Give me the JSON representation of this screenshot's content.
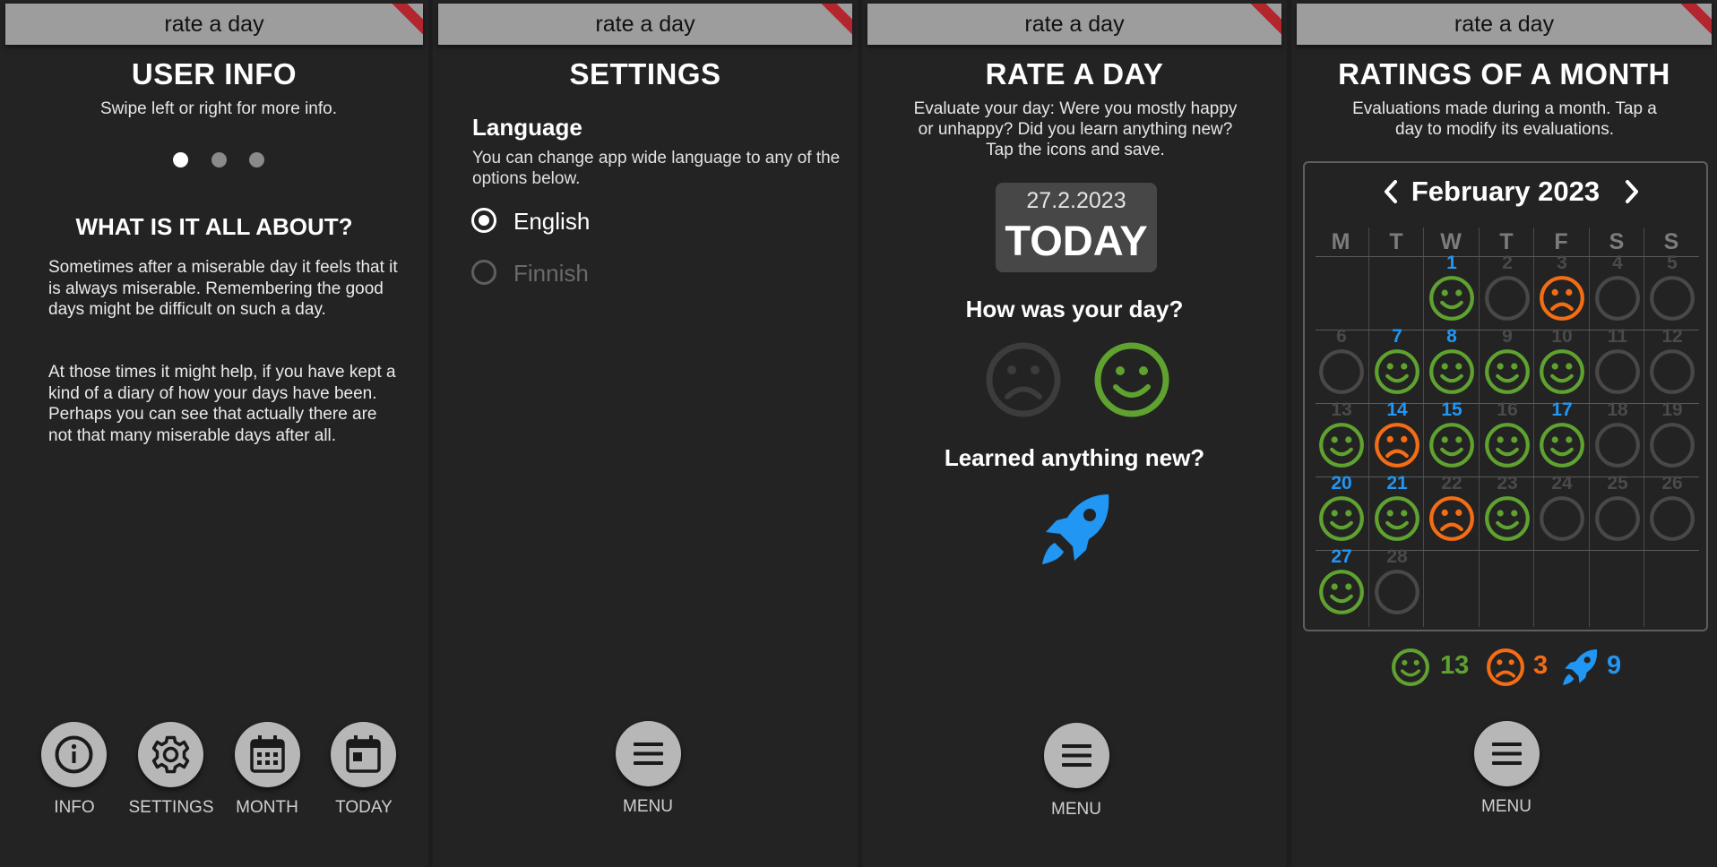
{
  "app_title": "rate a day",
  "colors": {
    "happy": "#5fa22f",
    "sad": "#f46d15",
    "learn": "#2196f3",
    "empty": "#484848"
  },
  "info": {
    "title": "USER INFO",
    "subtitle": "Swipe left or right for more info.",
    "heading": "WHAT IS IT ALL ABOUT?",
    "para1": "Sometimes after a miserable day it feels that it is always miserable. Remembering the good days might be difficult on such a day.",
    "para2": "At those times it might help, if you have kept a kind of a diary of how your days have been. Perhaps you can see that actually there are not that many miserable days after all.",
    "nav": [
      {
        "label": "INFO",
        "icon": "info-icon"
      },
      {
        "label": "SETTINGS",
        "icon": "gear-icon"
      },
      {
        "label": "MONTH",
        "icon": "calendar-month-icon"
      },
      {
        "label": "TODAY",
        "icon": "calendar-today-icon"
      }
    ]
  },
  "settings": {
    "title": "SETTINGS",
    "language_heading": "Language",
    "language_desc": "You can change app wide language to any of the options below.",
    "options": [
      {
        "label": "English",
        "selected": true
      },
      {
        "label": "Finnish",
        "selected": false
      }
    ],
    "menu_label": "MENU"
  },
  "rate": {
    "title": "RATE A DAY",
    "desc_line1": "Evaluate your day: Were you mostly happy",
    "desc_line2": "or unhappy? Did you learn anything new?",
    "desc_line3": "Tap the icons and save.",
    "date": "27.2.2023",
    "today": "TODAY",
    "how_question": "How was your day?",
    "learned_question": "Learned anything new?",
    "menu_label": "MENU"
  },
  "month": {
    "title": "RATINGS OF A MONTH",
    "desc_line1": "Evaluations made during a month. Tap a",
    "desc_line2": "day to modify its evaluations.",
    "month_label": "February 2023",
    "weekdays": [
      "M",
      "T",
      "W",
      "T",
      "F",
      "S",
      "S"
    ],
    "days": [
      {
        "n": "1",
        "c": 2,
        "r": 0,
        "mood": "happy",
        "learn": true
      },
      {
        "n": "2",
        "c": 3,
        "r": 0,
        "mood": "none",
        "learn": false
      },
      {
        "n": "3",
        "c": 4,
        "r": 0,
        "mood": "sad",
        "learn": false
      },
      {
        "n": "4",
        "c": 5,
        "r": 0,
        "mood": "none",
        "learn": false
      },
      {
        "n": "5",
        "c": 6,
        "r": 0,
        "mood": "none",
        "learn": false
      },
      {
        "n": "6",
        "c": 0,
        "r": 1,
        "mood": "none",
        "learn": false
      },
      {
        "n": "7",
        "c": 1,
        "r": 1,
        "mood": "happy",
        "learn": true
      },
      {
        "n": "8",
        "c": 2,
        "r": 1,
        "mood": "happy",
        "learn": true
      },
      {
        "n": "9",
        "c": 3,
        "r": 1,
        "mood": "happy",
        "learn": false
      },
      {
        "n": "10",
        "c": 4,
        "r": 1,
        "mood": "happy",
        "learn": false
      },
      {
        "n": "11",
        "c": 5,
        "r": 1,
        "mood": "none",
        "learn": false
      },
      {
        "n": "12",
        "c": 6,
        "r": 1,
        "mood": "none",
        "learn": false
      },
      {
        "n": "13",
        "c": 0,
        "r": 2,
        "mood": "happy",
        "learn": false
      },
      {
        "n": "14",
        "c": 1,
        "r": 2,
        "mood": "sad",
        "learn": true
      },
      {
        "n": "15",
        "c": 2,
        "r": 2,
        "mood": "happy",
        "learn": true
      },
      {
        "n": "16",
        "c": 3,
        "r": 2,
        "mood": "happy",
        "learn": false
      },
      {
        "n": "17",
        "c": 4,
        "r": 2,
        "mood": "happy",
        "learn": true
      },
      {
        "n": "18",
        "c": 5,
        "r": 2,
        "mood": "none",
        "learn": false
      },
      {
        "n": "19",
        "c": 6,
        "r": 2,
        "mood": "none",
        "learn": false
      },
      {
        "n": "20",
        "c": 0,
        "r": 3,
        "mood": "happy",
        "learn": true
      },
      {
        "n": "21",
        "c": 1,
        "r": 3,
        "mood": "happy",
        "learn": true
      },
      {
        "n": "22",
        "c": 2,
        "r": 3,
        "mood": "sad",
        "learn": false
      },
      {
        "n": "23",
        "c": 3,
        "r": 3,
        "mood": "happy",
        "learn": false
      },
      {
        "n": "24",
        "c": 4,
        "r": 3,
        "mood": "none",
        "learn": false
      },
      {
        "n": "25",
        "c": 5,
        "r": 3,
        "mood": "none",
        "learn": false
      },
      {
        "n": "26",
        "c": 6,
        "r": 3,
        "mood": "none",
        "learn": false
      },
      {
        "n": "27",
        "c": 0,
        "r": 4,
        "mood": "happy",
        "learn": true
      },
      {
        "n": "28",
        "c": 1,
        "r": 4,
        "mood": "none",
        "learn": false
      }
    ],
    "happy_count": "13",
    "sad_count": "3",
    "learn_count": "9",
    "menu_label": "MENU"
  }
}
